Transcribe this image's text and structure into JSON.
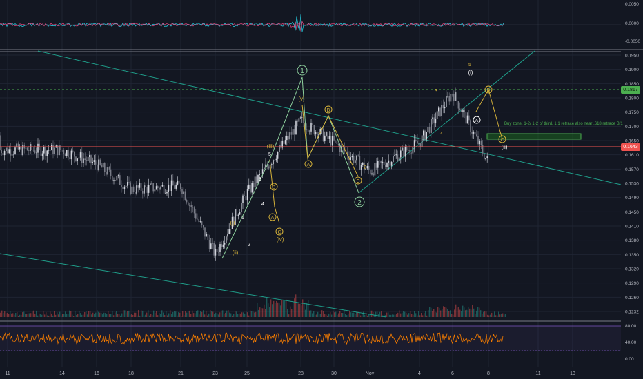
{
  "colors": {
    "background": "#131722",
    "grid": "#1f2433",
    "axis_text": "#b2b5be",
    "candle_up": "#d1d4dc",
    "candle_down": "#787b86",
    "trendline": "#1f9e8a",
    "wave_yellow": "#d5b23a",
    "wave_green": "#8fd19e",
    "green_level": "#4caf50",
    "red_level": "#ef5350",
    "rsi": "#f57c00",
    "rsi_band": "#7e57c2"
  },
  "price_axis": {
    "ticks": [
      "0.1950",
      "0.1900",
      "0.1850",
      "0.1800",
      "0.1750",
      "0.1700",
      "0.1650",
      "0.1610",
      "0.1570",
      "0.1530",
      "0.1490",
      "0.1450",
      "0.1410",
      "0.1380",
      "0.1350",
      "0.1320",
      "0.1290",
      "0.1260",
      "0.1232"
    ],
    "top_label": "0.1950",
    "green_tag": "0.1817",
    "red_tag": "0.1643"
  },
  "oscillator_axis": {
    "ticks": [
      "0.0050",
      "0.0000",
      "-0.0050"
    ]
  },
  "rsi_axis": {
    "ticks": [
      "80.00",
      "40.00",
      "0.00"
    ]
  },
  "time_axis": {
    "ticks": [
      "11",
      "14",
      "16",
      "18",
      "21",
      "23",
      "25",
      "28",
      "30",
      "Nov",
      "4",
      "6",
      "8",
      "11",
      "13"
    ]
  },
  "annotation": "Buy zone. 1-2/ 1-2 of third. 1:1 retrace also near .618 retrace B/1",
  "wave_labels": {
    "one_circle": "1",
    "two_circle": "2",
    "i": "(i)",
    "ii": "(ii)",
    "iii": "(iii)",
    "iv": "(iv)",
    "v": "(v)",
    "A": "A",
    "B": "B",
    "C": "C",
    "n1": "1",
    "n2": "2",
    "n3": "3",
    "n4": "4",
    "n5": "5",
    "top_i": "(i)",
    "top_ii": "(ii)",
    "top_5": "5",
    "top_3": "3",
    "top_4": "4",
    "small_2": "2"
  },
  "chart_data": {
    "type": "candlestick",
    "title": "",
    "x_categories": [
      "11",
      "14",
      "16",
      "18",
      "21",
      "23",
      "25",
      "28",
      "30",
      "Nov",
      "4",
      "6",
      "8",
      "11",
      "13"
    ],
    "price_range": [
      0.1232,
      0.195
    ],
    "price_path_anchors": [
      {
        "x": "11",
        "price": 0.172
      },
      {
        "x": "14",
        "price": 0.168
      },
      {
        "x": "16",
        "price": 0.164
      },
      {
        "x": "18",
        "price": 0.157
      },
      {
        "x": "21",
        "price": 0.158
      },
      {
        "x": "23",
        "price": 0.139
      },
      {
        "x": "25",
        "price": 0.156
      },
      {
        "x": "28",
        "price": 0.176
      },
      {
        "x": "30",
        "price": 0.17
      },
      {
        "x": "Nov",
        "price": 0.162
      },
      {
        "x": "4",
        "price": 0.17
      },
      {
        "x": "6",
        "price": 0.184
      },
      {
        "x": "8",
        "price": 0.1643
      }
    ],
    "horizontal_levels": [
      {
        "price": 0.1817,
        "style": "dashed",
        "color": "green"
      },
      {
        "price": 0.1643,
        "style": "solid",
        "color": "red"
      }
    ],
    "buy_zone": {
      "price_top": 0.168,
      "price_bottom": 0.1665
    },
    "oscillator_range": [
      -0.005,
      0.005
    ],
    "rsi_range": [
      0,
      80
    ],
    "rsi_bands": [
      80,
      20
    ],
    "grid": true
  }
}
